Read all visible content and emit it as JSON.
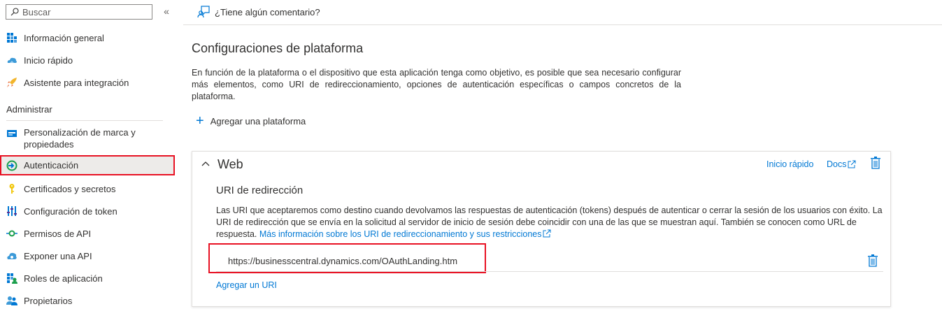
{
  "sidebar": {
    "search_placeholder": "Buscar",
    "collapse_icon": "double-chevron-left-icon",
    "items_top": [
      {
        "label": "Información general",
        "icon": "overview-grid-icon"
      },
      {
        "label": "Inicio rápido",
        "icon": "cloud-quickstart-icon"
      },
      {
        "label": "Asistente para integración",
        "icon": "rocket-icon"
      }
    ],
    "section_label": "Administrar",
    "items_manage": [
      {
        "label": "Personalización de marca y propiedades",
        "icon": "branding-card-icon"
      },
      {
        "label": "Autenticación",
        "icon": "authentication-icon",
        "selected": true
      },
      {
        "label": "Certificados y secretos",
        "icon": "key-icon"
      },
      {
        "label": "Configuración de token",
        "icon": "token-bars-icon"
      },
      {
        "label": "Permisos de API",
        "icon": "api-permissions-icon"
      },
      {
        "label": "Exponer una API",
        "icon": "expose-api-cloud-icon"
      },
      {
        "label": "Roles de aplicación",
        "icon": "app-roles-icon"
      },
      {
        "label": "Propietarios",
        "icon": "owners-people-icon"
      }
    ]
  },
  "topbar": {
    "feedback_label": "¿Tiene algún comentario?",
    "feedback_icon": "feedback-person-icon"
  },
  "main": {
    "title": "Configuraciones de plataforma",
    "description": "En función de la plataforma o el dispositivo que esta aplicación tenga como objetivo, es posible que sea necesario configurar más elementos, como URI de redireccionamiento, opciones de autenticación específicas o campos concretos de la plataforma.",
    "add_platform_label": "Agregar una plataforma",
    "web_card": {
      "title": "Web",
      "quickstart_link": "Inicio rápido",
      "docs_link": "Docs",
      "redirect_title": "URI de redirección",
      "redirect_desc": "Las URI que aceptaremos como destino cuando devolvamos las respuestas de autenticación (tokens) después de autenticar o cerrar la sesión de los usuarios con éxito. La URI de redirección que se envía en la solicitud al servidor de inicio de sesión debe coincidir con una de las que se muestran aquí. También se conocen como URL de respuesta.",
      "more_info_link": "Más información sobre los URI de redireccionamiento y sus restricciones",
      "redirect_uri": "https://businesscentral.dynamics.com/OAuthLanding.htm",
      "add_uri_label": "Agregar un URI"
    }
  },
  "colors": {
    "accent": "#0078d4",
    "highlight": "#e81123",
    "text": "#323130",
    "selected_bg": "#edebe9"
  }
}
